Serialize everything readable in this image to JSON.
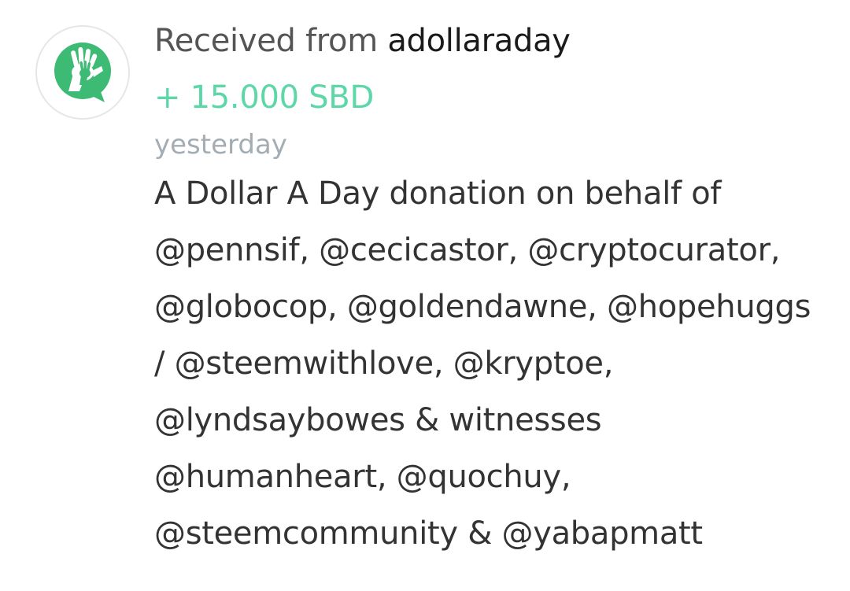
{
  "transaction": {
    "avatar_icon": "adollaraday-hand-icon",
    "title_prefix": "Received from",
    "sender": "adollaraday",
    "amount": "+ 15.000 SBD",
    "time": "yesterday",
    "memo_lines": [
      "A Dollar A Day donation on behalf of",
      "@pennsif, @cecicastor, @cryptocurator,",
      "@globocop, @goldendawne, @hopehuggs",
      "/ @steemwithlove, @kryptoe,",
      "@lyndsaybowes & witnesses",
      "@humanheart, @quochuy,",
      "@steemcommunity & @yabapmatt"
    ]
  },
  "colors": {
    "amount": "#5cd7a8",
    "avatar_green": "#3dba74",
    "time": "#a3adb3"
  }
}
